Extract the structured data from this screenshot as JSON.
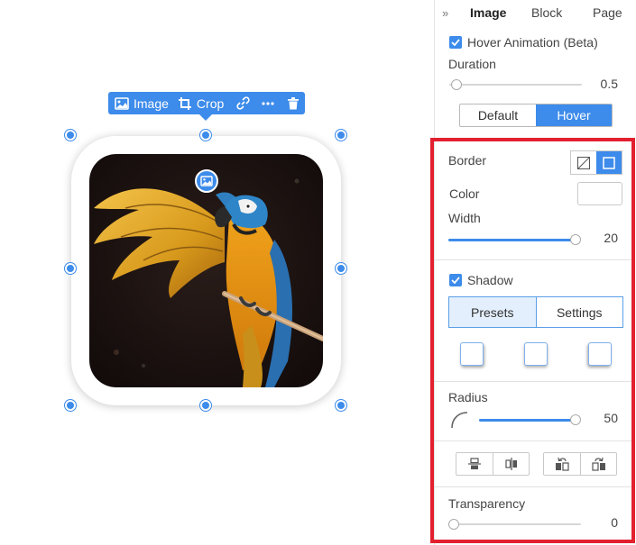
{
  "toolbar": {
    "image_label": "Image",
    "crop_label": "Crop",
    "link_icon": "link-icon",
    "more_icon": "more-icon",
    "delete_icon": "trash-icon"
  },
  "panel": {
    "tabs": [
      {
        "label": "Image",
        "active": true
      },
      {
        "label": "Block",
        "active": false
      },
      {
        "label": "Page",
        "active": false
      }
    ],
    "hover_animation": {
      "label": "Hover Animation (Beta)",
      "checked": true
    },
    "duration": {
      "label": "Duration",
      "value": "0.5"
    },
    "state_toggle": {
      "default_label": "Default",
      "hover_label": "Hover",
      "selected": "Hover"
    },
    "border": {
      "label": "Border",
      "enabled": true
    },
    "color": {
      "label": "Color",
      "value": "#ffffff"
    },
    "width": {
      "label": "Width",
      "value": "20"
    },
    "shadow": {
      "label": "Shadow",
      "checked": true,
      "presets_label": "Presets",
      "settings_label": "Settings",
      "selected": "Presets"
    },
    "radius": {
      "label": "Radius",
      "value": "50"
    },
    "transparency": {
      "label": "Transparency",
      "value": "0"
    }
  },
  "colors": {
    "accent": "#3d8bea",
    "highlight_border": "#e2202f"
  }
}
